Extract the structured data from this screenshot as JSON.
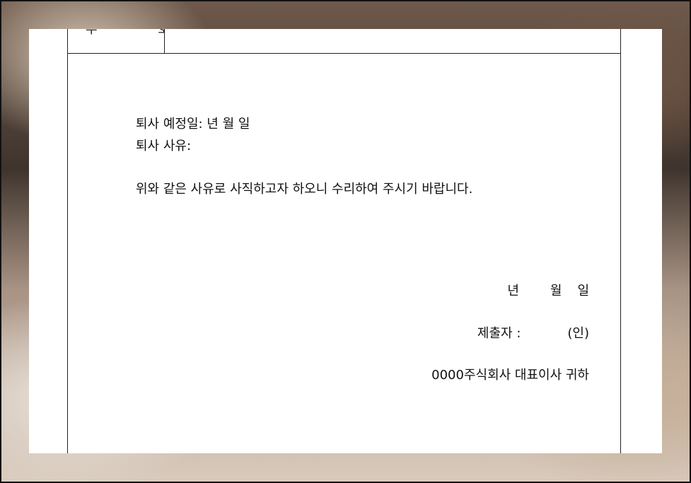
{
  "document": {
    "header_label": "부 호",
    "resign_date_line": "퇴사 예정일: 년 월 일",
    "resign_reason_line": "퇴사 사유:",
    "request_line": "위와 같은 사유로 사직하고자 하오니 수리하여 주시기 바랍니다.",
    "sign_date": {
      "year": "년",
      "month": "월",
      "day": "일"
    },
    "submitter_label": "제출자 :",
    "seal_label": "(인)",
    "recipient": "0000주식회사 대표이사 귀하"
  }
}
